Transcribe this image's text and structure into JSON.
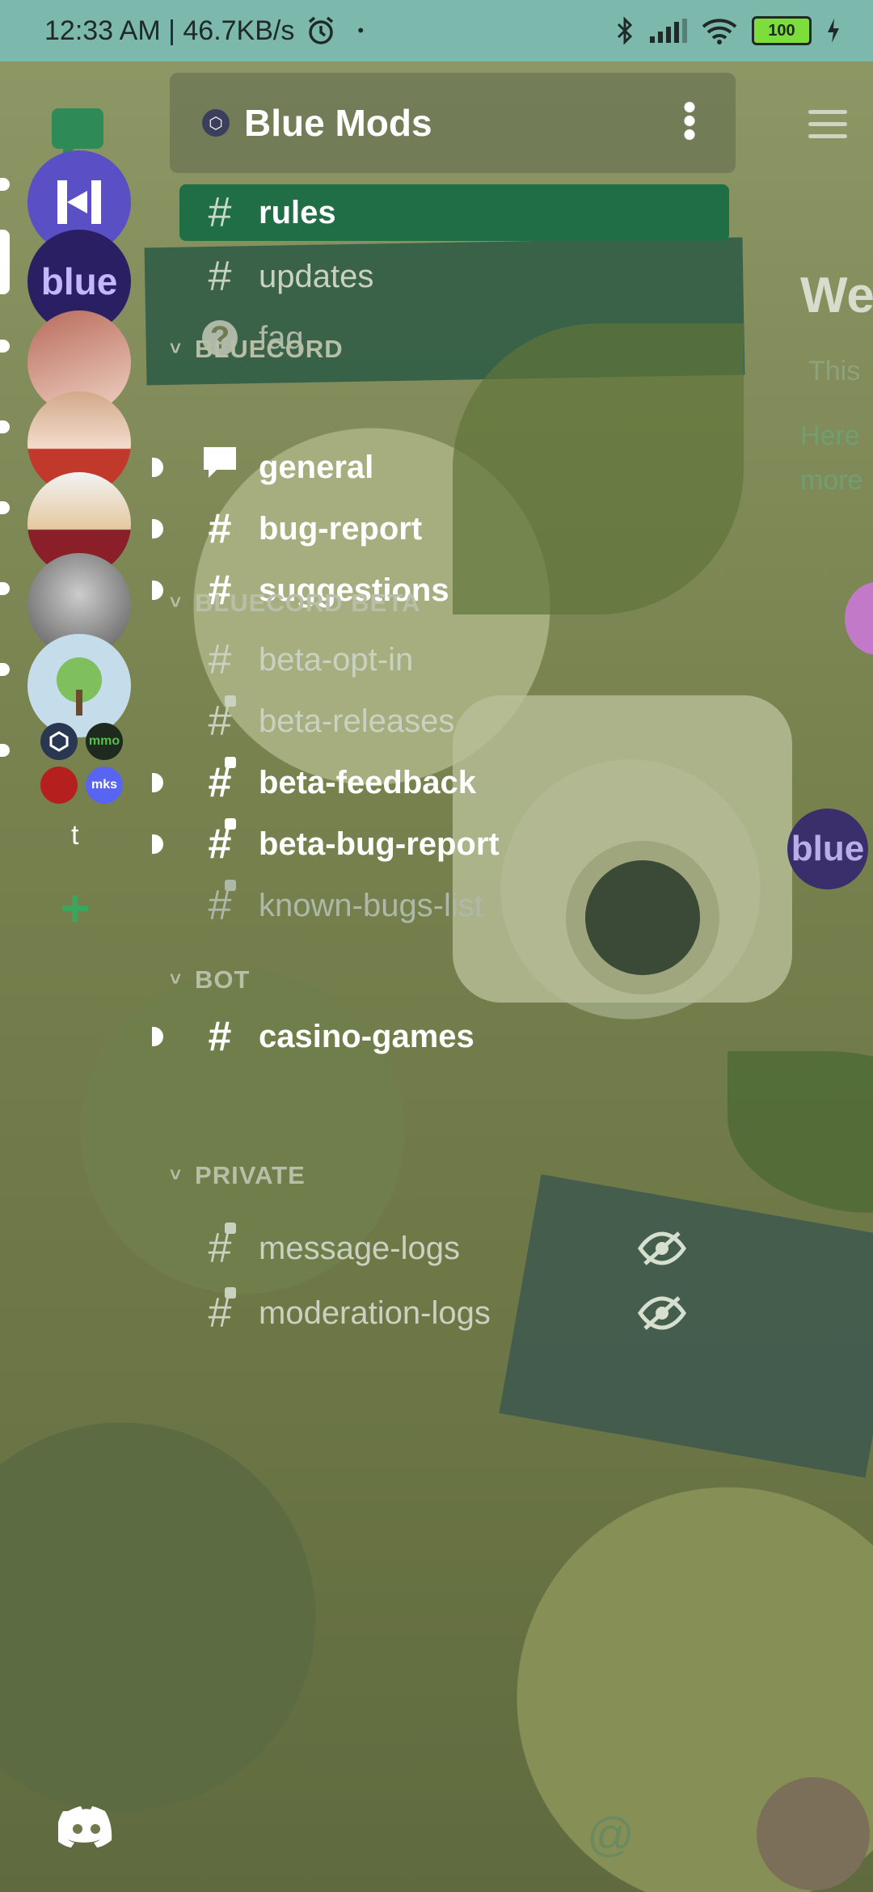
{
  "status_bar": {
    "time": "12:33 AM | 46.7KB/s",
    "battery": "100",
    "icons": [
      "alarm-icon",
      "bluetooth-icon",
      "signal-icon",
      "wifi-icon",
      "battery-icon",
      "charging-icon"
    ]
  },
  "server": {
    "name": "Blue Mods"
  },
  "rail": {
    "servers": [
      {
        "name": "server-h",
        "color": "#5a4fc4",
        "text": ""
      },
      {
        "name": "server-blue",
        "color": "#2a1f63",
        "text": "blue"
      },
      {
        "name": "server-anime",
        "color": "#c98a7e",
        "text": ""
      },
      {
        "name": "server-girl",
        "color": "#e8b8a0",
        "text": ""
      },
      {
        "name": "server-cartoon",
        "color": "#e2e6ea",
        "text": ""
      },
      {
        "name": "server-bw",
        "color": "#9a9a9a",
        "text": ""
      },
      {
        "name": "server-tree",
        "color": "#c5ddea",
        "text": ""
      }
    ],
    "folder_minis": [
      "",
      "mmo",
      "",
      "mks"
    ],
    "text_server": "t",
    "add_server": "+"
  },
  "categories": [
    {
      "key": "bluecord",
      "label": "BLUECORD"
    },
    {
      "key": "bluecord_beta",
      "label": "BLUECORD BETA"
    },
    {
      "key": "bot",
      "label": "BOT"
    },
    {
      "key": "private",
      "label": "PRIVATE"
    }
  ],
  "channels": {
    "rules": "rules",
    "updates": "updates",
    "faq": "faq",
    "general": "general",
    "bug_report": "bug-report",
    "suggestions": "suggestions",
    "beta_opt_in": "beta-opt-in",
    "beta_releases": "beta-releases",
    "beta_feedback": "beta-feedback",
    "beta_bug_report": "beta-bug-report",
    "known_bugs_list": "known-bugs-list",
    "casino_games": "casino-games",
    "message_logs": "message-logs",
    "moderation_logs": "moderation-logs"
  },
  "background_text": {
    "welcome": "We",
    "line1": "This",
    "line2": "Here",
    "line3": "more",
    "blue_badge": "blue"
  },
  "colors": {
    "accent_green": "#1f6e45",
    "status_bar": "#7db8ad"
  }
}
